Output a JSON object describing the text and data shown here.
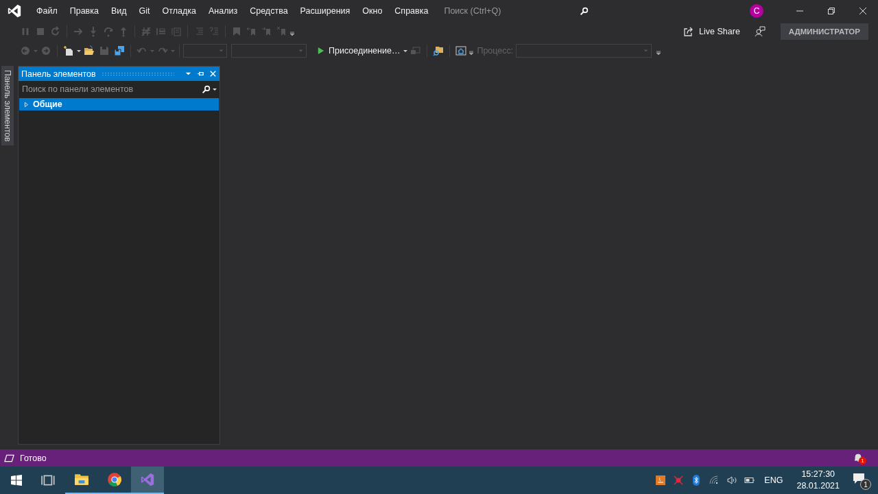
{
  "window": {
    "menu": [
      "Файл",
      "Правка",
      "Вид",
      "Git",
      "Отладка",
      "Анализ",
      "Средства",
      "Расширения",
      "Окно",
      "Справка"
    ],
    "search": {
      "placeholder": "Поиск (Ctrl+Q)"
    },
    "account": {
      "initial": "C"
    }
  },
  "toolbar": {
    "live_share": "Live Share",
    "role_badge": "АДМИНИСТРАТОР",
    "attach_button": "Присоединение…",
    "process_label": "Процесс:"
  },
  "side_tab": "Панель элементов",
  "toolbox": {
    "title": "Панель элементов",
    "search": {
      "placeholder": "Поиск по панели элементов"
    },
    "groups": [
      {
        "label": "Общие",
        "expanded": false,
        "selected": true
      }
    ]
  },
  "status_bar": {
    "text": "Готово",
    "notifications": "1"
  },
  "taskbar": {
    "apps": [
      {
        "kind": "task-view",
        "running": false,
        "selected": false
      },
      {
        "kind": "explorer",
        "running": true,
        "selected": false
      },
      {
        "kind": "chrome",
        "running": true,
        "selected": false
      },
      {
        "kind": "vs",
        "running": true,
        "selected": true
      }
    ],
    "language": "ENG",
    "time": "15:27:30",
    "date": "28.01.2021",
    "notifications": "1"
  }
}
